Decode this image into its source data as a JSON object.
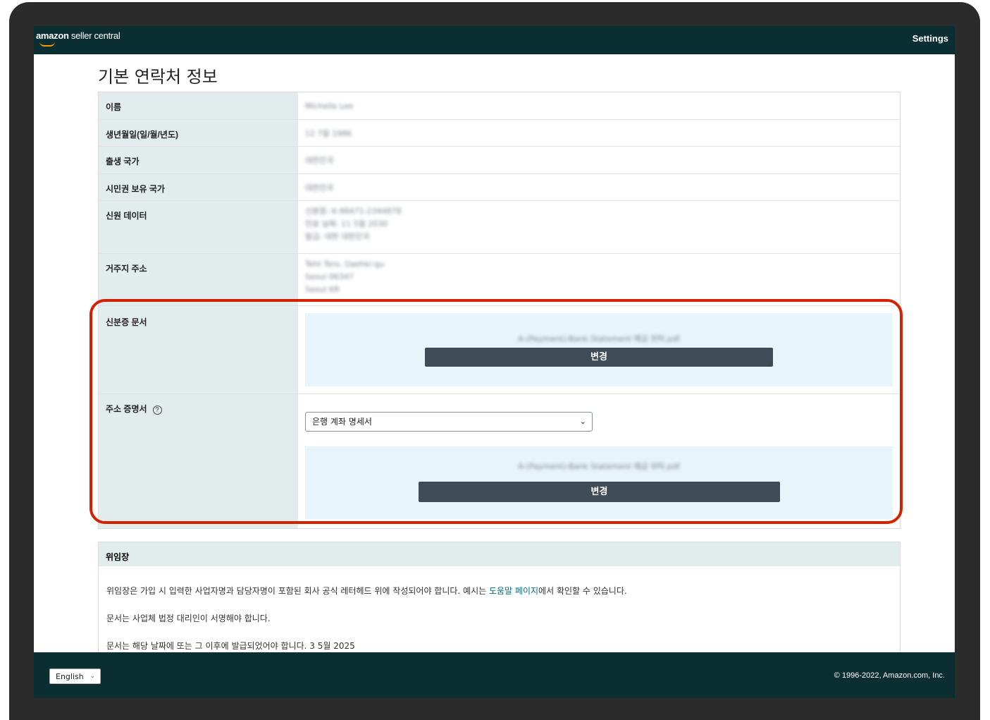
{
  "header": {
    "logo_bold": "amazon",
    "logo_rest": " seller central",
    "settings_label": "Settings"
  },
  "page_title": "기본 연락처 정보",
  "rows": [
    {
      "label": "이름",
      "value": "Michelle Lee"
    },
    {
      "label": "생년월일(일/월/년도)",
      "value": "12 7월 1986"
    },
    {
      "label": "출생 국가",
      "value": "대한민국"
    },
    {
      "label": "시민권 보유 국가",
      "value": "대한민국"
    },
    {
      "label": "신원 데이터",
      "value_lines": [
        "신분증: 6-98471-2344878",
        "만료 날짜: 11 5월 2030",
        "발급: 대한 대한민국"
      ]
    },
    {
      "label": "거주지 주소",
      "value_lines": [
        "Teht Tero, Gaehki-gu",
        "Seoul 06347",
        "Seoul KR"
      ]
    }
  ],
  "id_doc": {
    "label": "신분증 문서",
    "file_name": "A-(Payment)-Bank Statement 예금 위탁.pdf",
    "change_label": "변경"
  },
  "address_proof": {
    "label": "주소 증명서",
    "help_icon": "?",
    "select_value": "은행 계좌 명세서",
    "file_name": "A-(Payment)-Bank Statement 예금 위탁.pdf",
    "change_label": "변경"
  },
  "power_of_attorney": {
    "title": "위임장",
    "line1_before": "위임장은 가입 시 입력한 사업자명과 담당자명이 포함된 회사 공식 레터헤드 위에 작성되어야 합니다. 예시는 ",
    "line1_link": "도움말 페이지",
    "line1_after": "에서 확인할 수 있습니다.",
    "line2": "문서는 사업체 법정 대리인이 서명해야 합니다.",
    "line3": "문서는 해당 날짜에 또는 그 이후에 발급되었어야 합니다. 3 5월 2025"
  },
  "footer": {
    "language": "English",
    "copyright": "© 1996-2022, Amazon.com, Inc."
  },
  "colors": {
    "topbar": "#0b2e33",
    "highlight": "#d42200",
    "button": "#404b58",
    "upload_bg": "#e8f4fb",
    "label_bg": "#e3ecec"
  }
}
